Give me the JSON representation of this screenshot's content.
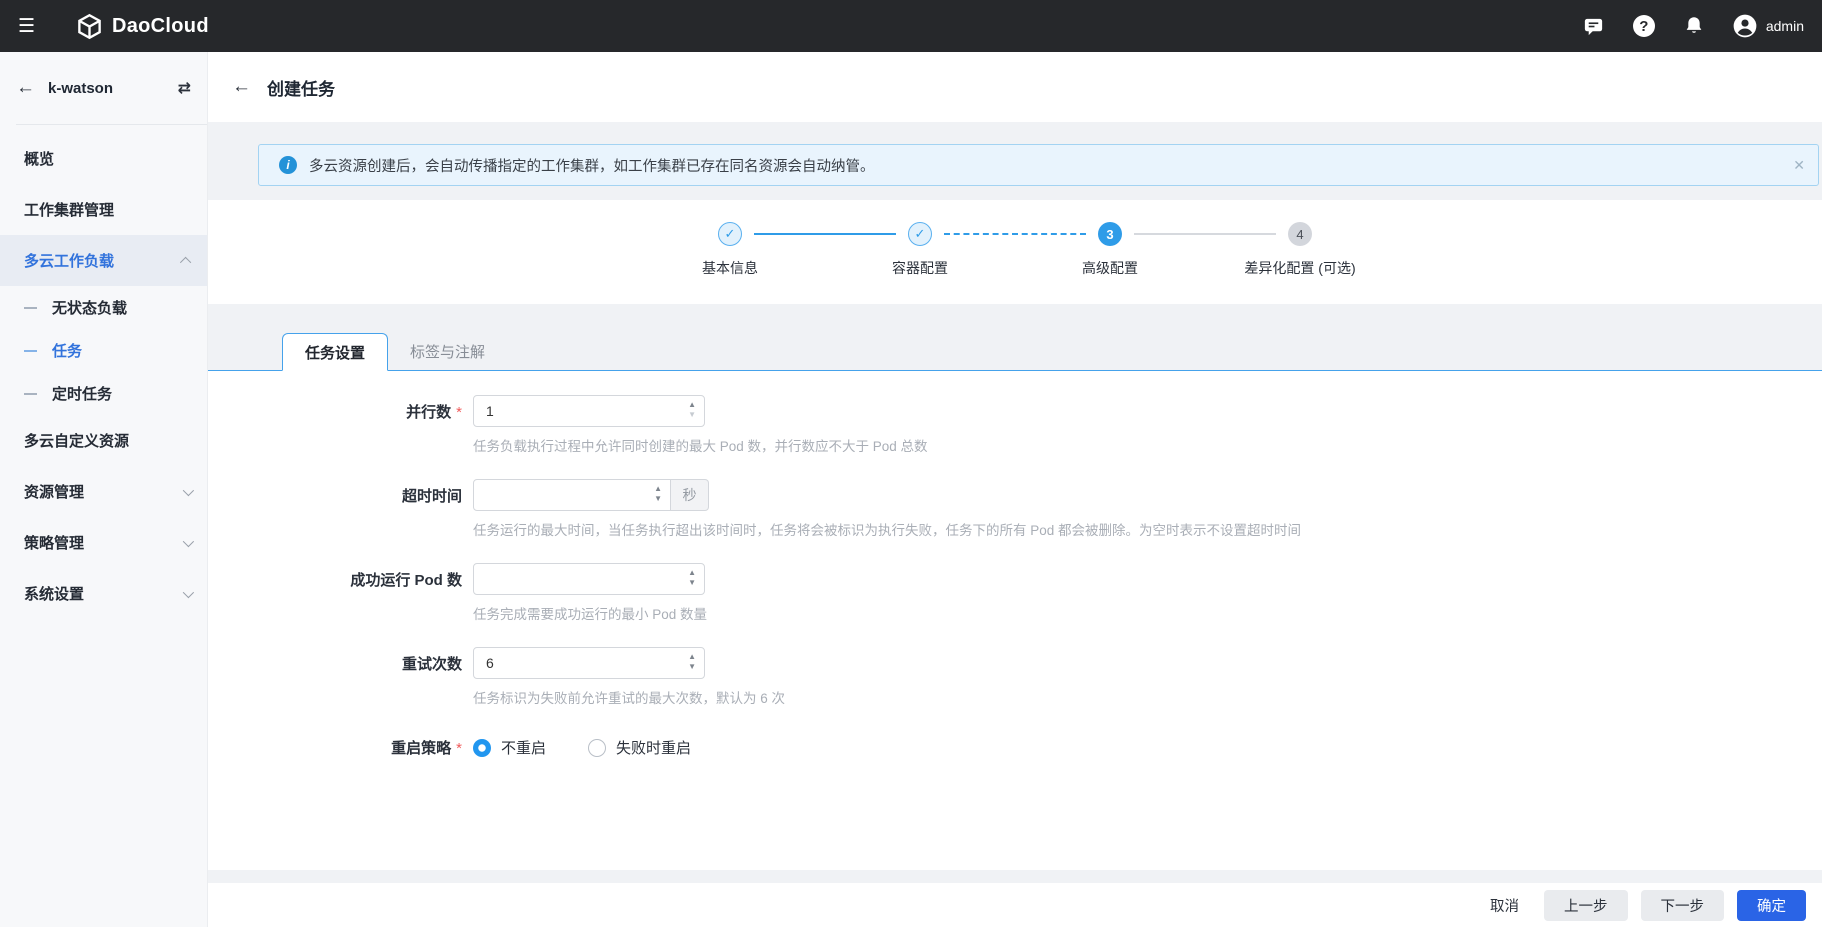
{
  "topbar": {
    "brand": "DaoCloud",
    "user": "admin"
  },
  "icons": {
    "hamburger": "☰",
    "back": "←",
    "swap": "⇄",
    "close": "✕",
    "help": "?",
    "info": "i",
    "spin_up": "▲",
    "spin_down": "▼"
  },
  "sidebar": {
    "workspace": "k-watson",
    "items": [
      {
        "label": "概览"
      },
      {
        "label": "工作集群管理"
      },
      {
        "label": "多云工作负载",
        "active": true,
        "expanded": true
      },
      {
        "label": "无状态负载",
        "sub": true
      },
      {
        "label": "任务",
        "sub": true,
        "selected": true
      },
      {
        "label": "定时任务",
        "sub": true
      },
      {
        "label": "多云自定义资源"
      },
      {
        "label": "资源管理",
        "collapsible": true
      },
      {
        "label": "策略管理",
        "collapsible": true
      },
      {
        "label": "系统设置",
        "collapsible": true
      }
    ]
  },
  "header": {
    "title": "创建任务"
  },
  "banner": {
    "text": "多云资源创建后，会自动传播指定的工作集群，如工作集群已存在同名资源会自动纳管。"
  },
  "stepper": {
    "steps": [
      {
        "label": "基本信息",
        "state": "done",
        "symbol": "✓"
      },
      {
        "label": "容器配置",
        "state": "done",
        "symbol": "✓"
      },
      {
        "label": "高级配置",
        "state": "active",
        "symbol": "3"
      },
      {
        "label": "差异化配置 (可选)",
        "state": "pending",
        "symbol": "4"
      }
    ]
  },
  "tabs": [
    {
      "label": "任务设置",
      "active": true
    },
    {
      "label": "标签与注解",
      "active": false
    }
  ],
  "form": {
    "required_mark": "*",
    "fields": [
      {
        "label": "并行数",
        "required": true,
        "value": "1",
        "help": "任务负载执行过程中允许同时创建的最大 Pod 数，并行数应不大于 Pod 总数"
      },
      {
        "label": "超时时间",
        "required": false,
        "value": "",
        "suffix": "秒",
        "help": "任务运行的最大时间，当任务执行超出该时间时，任务将会被标识为执行失败，任务下的所有 Pod 都会被删除。为空时表示不设置超时时间"
      },
      {
        "label": "成功运行 Pod 数",
        "required": false,
        "value": "",
        "help": "任务完成需要成功运行的最小 Pod 数量"
      },
      {
        "label": "重试次数",
        "required": false,
        "value": "6",
        "help": "任务标识为失败前允许重试的最大次数，默认为 6 次"
      }
    ],
    "restart_policy": {
      "label": "重启策略",
      "required": true,
      "options": [
        {
          "label": "不重启",
          "selected": true
        },
        {
          "label": "失败时重启",
          "selected": false
        }
      ]
    }
  },
  "footer": {
    "cancel": "取消",
    "prev": "上一步",
    "next": "下一步",
    "confirm": "确定"
  },
  "colors": {
    "topbar_bg": "#26282b",
    "primary_blue": "#2a64e6",
    "stepper_blue": "#2f9ce8",
    "link_blue": "#3273dc",
    "banner_bg": "#e9f4fd",
    "banner_border": "#a3d3f2",
    "required_red": "#f05b5b",
    "nav_active_bg": "#e8ecf3",
    "page_bg": "#f0f2f5"
  }
}
